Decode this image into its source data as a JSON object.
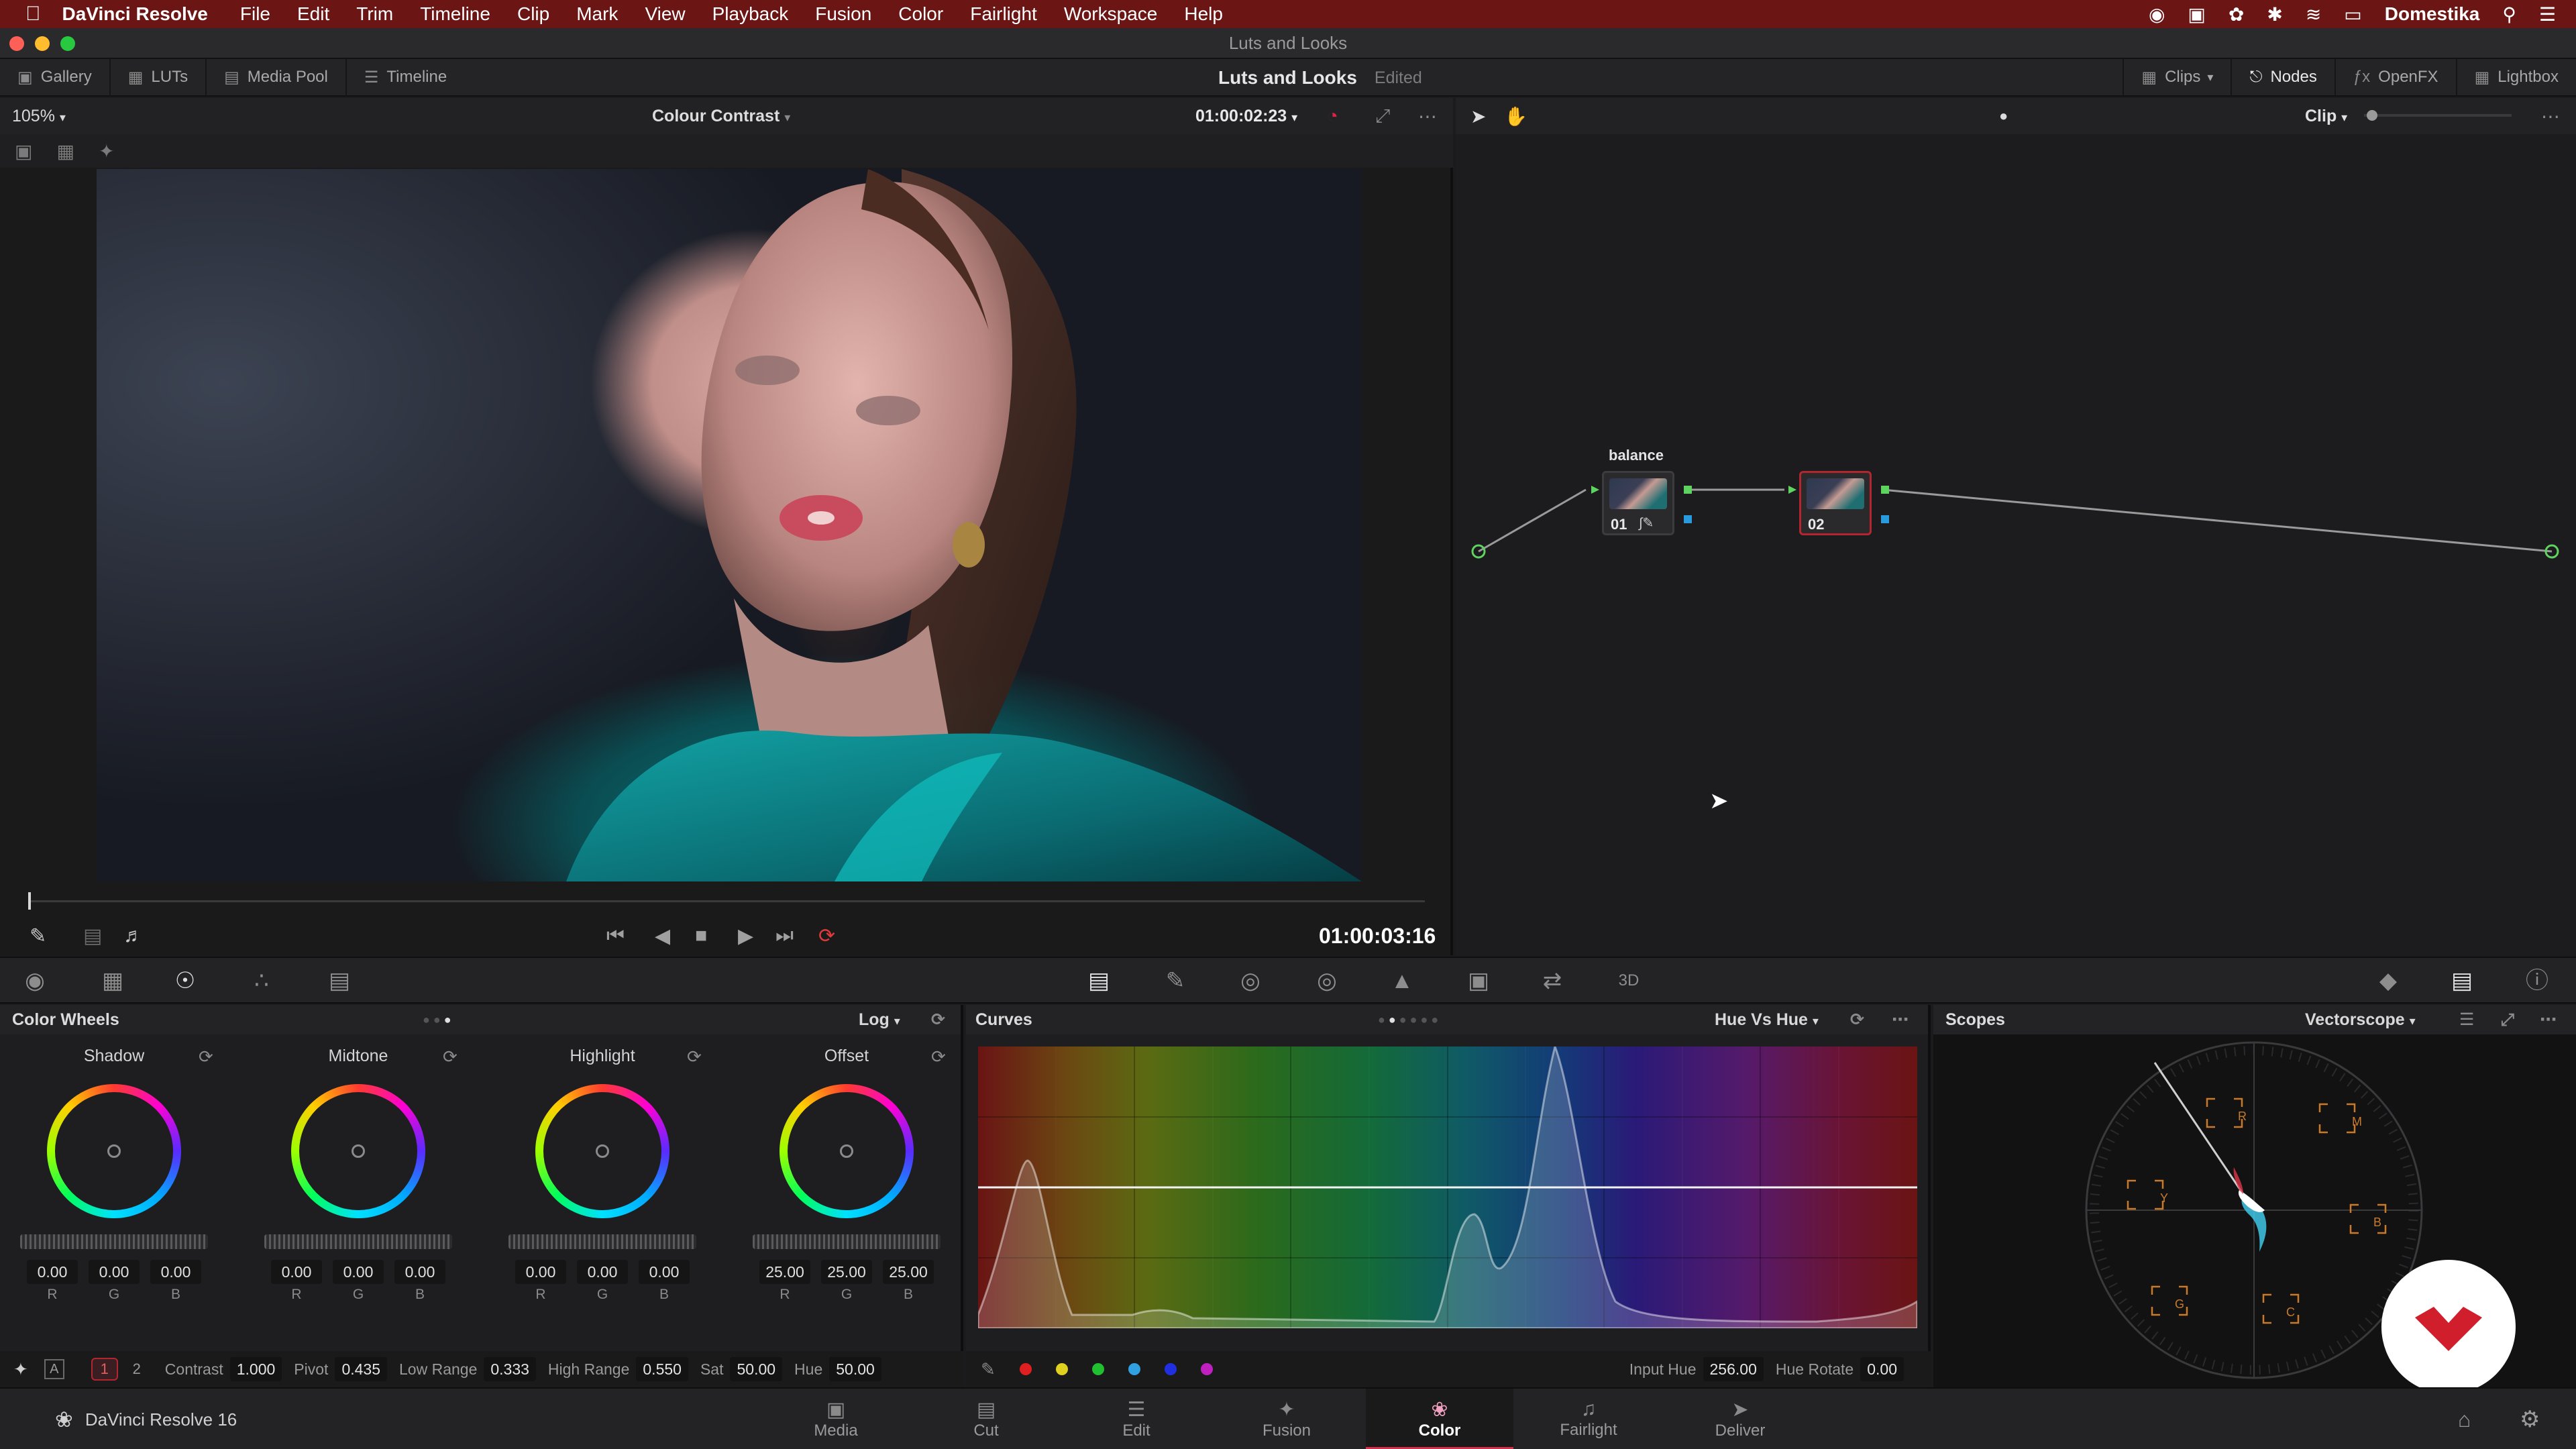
{
  "menubar": {
    "app": "DaVinci Resolve",
    "items": [
      "File",
      "Edit",
      "Trim",
      "Timeline",
      "Clip",
      "Mark",
      "View",
      "Playback",
      "Fusion",
      "Color",
      "Fairlight",
      "Workspace",
      "Help"
    ],
    "user": "Domestika"
  },
  "window": {
    "title": "Luts and Looks"
  },
  "toolbar": {
    "left": [
      {
        "label": "Gallery",
        "icon": "gallery-icon"
      },
      {
        "label": "LUTs",
        "icon": "luts-icon"
      },
      {
        "label": "Media Pool",
        "icon": "media-pool-icon"
      },
      {
        "label": "Timeline",
        "icon": "timeline-icon"
      }
    ],
    "project": "Luts and Looks",
    "status": "Edited",
    "right": [
      {
        "label": "Clips",
        "icon": "clips-icon"
      },
      {
        "label": "Nodes",
        "icon": "nodes-icon"
      },
      {
        "label": "OpenFX",
        "icon": "openfx-icon"
      },
      {
        "label": "Lightbox",
        "icon": "lightbox-icon"
      }
    ]
  },
  "viewer": {
    "zoom": "105%",
    "clip_name": "Colour Contrast",
    "source_timecode": "01:00:02:23",
    "record_timecode": "01:00:03:16"
  },
  "nodes": {
    "mode": "Clip",
    "node1": {
      "label": "01",
      "name": "balance"
    },
    "node2": {
      "label": "02"
    }
  },
  "color_wheels": {
    "title": "Color Wheels",
    "mode": "Log",
    "wheels": [
      {
        "name": "Shadow",
        "values": [
          "0.00",
          "0.00",
          "0.00"
        ]
      },
      {
        "name": "Midtone",
        "values": [
          "0.00",
          "0.00",
          "0.00"
        ]
      },
      {
        "name": "Highlight",
        "values": [
          "0.00",
          "0.00",
          "0.00"
        ]
      },
      {
        "name": "Offset",
        "values": [
          "25.00",
          "25.00",
          "25.00"
        ]
      }
    ],
    "channels": [
      "R",
      "G",
      "B"
    ],
    "pages": [
      "1",
      "2"
    ],
    "params": [
      {
        "label": "Contrast",
        "value": "1.000"
      },
      {
        "label": "Pivot",
        "value": "0.435"
      },
      {
        "label": "Low Range",
        "value": "0.333"
      },
      {
        "label": "High Range",
        "value": "0.550"
      },
      {
        "label": "Sat",
        "value": "50.00"
      },
      {
        "label": "Hue",
        "value": "50.00"
      }
    ]
  },
  "curves": {
    "title": "Curves",
    "mode": "Hue Vs Hue",
    "input_hue_label": "Input Hue",
    "input_hue": "256.00",
    "hue_rotate_label": "Hue Rotate",
    "hue_rotate": "0.00",
    "swatches": [
      "#e02020",
      "#e0d020",
      "#20c030",
      "#30a0e0",
      "#2030e0",
      "#c020c0"
    ]
  },
  "scopes": {
    "title": "Scopes",
    "mode": "Vectorscope",
    "targets": [
      "R",
      "M",
      "Y",
      "B",
      "G",
      "C"
    ]
  },
  "footer": {
    "product": "DaVinci Resolve 16",
    "pages": [
      {
        "label": "Media",
        "icon": "media-page-icon"
      },
      {
        "label": "Cut",
        "icon": "cut-page-icon"
      },
      {
        "label": "Edit",
        "icon": "edit-page-icon"
      },
      {
        "label": "Fusion",
        "icon": "fusion-page-icon"
      },
      {
        "label": "Color",
        "icon": "color-page-icon"
      },
      {
        "label": "Fairlight",
        "icon": "fairlight-page-icon"
      },
      {
        "label": "Deliver",
        "icon": "deliver-page-icon"
      }
    ],
    "active": "Color"
  },
  "colors": {
    "menubar": "#6b1515",
    "accent": "#d32f4a",
    "node_link": "#5fd35f",
    "badge": "#d01e2c"
  }
}
